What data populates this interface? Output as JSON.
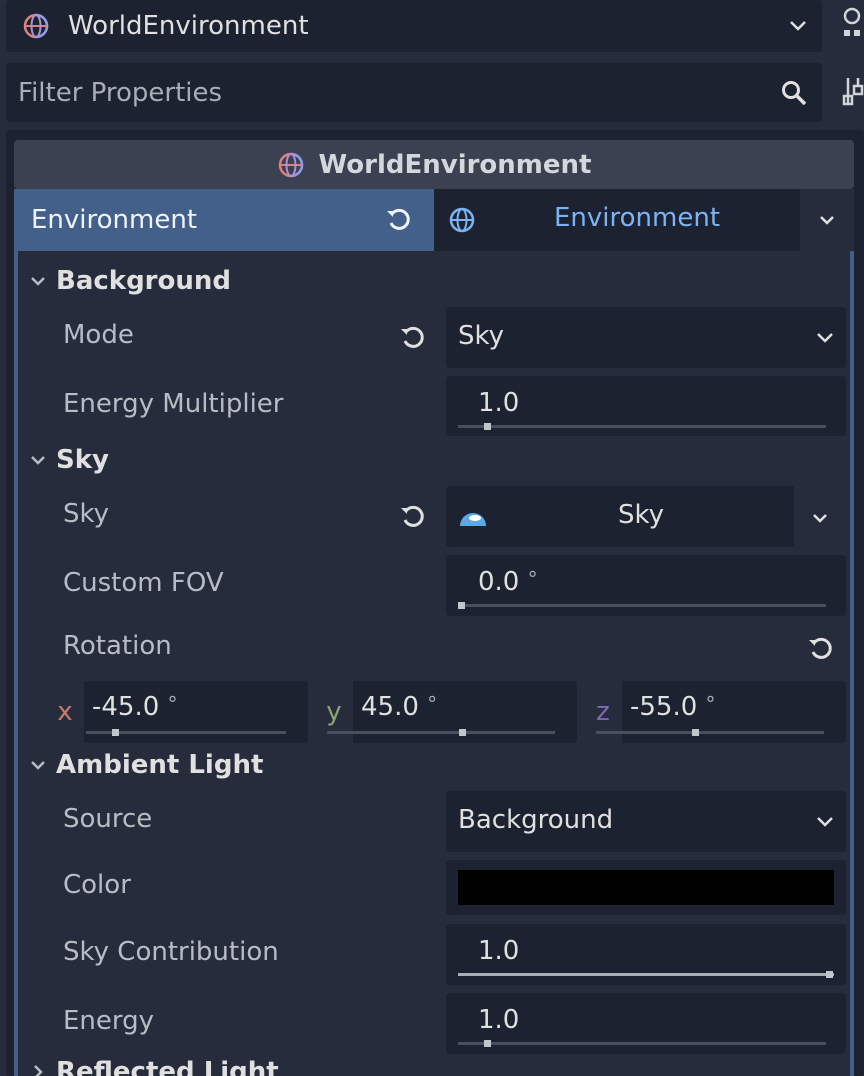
{
  "node_selector": {
    "name": "WorldEnvironment"
  },
  "filter": {
    "placeholder": "Filter Properties"
  },
  "object_header": {
    "title": "WorldEnvironment"
  },
  "environment_property": {
    "label": "Environment",
    "resource": "Environment"
  },
  "sections": {
    "background": {
      "title": "Background",
      "mode": {
        "label": "Mode",
        "value": "Sky"
      },
      "energy_multiplier": {
        "label": "Energy Multiplier",
        "value": "1.0",
        "slider_fraction": 0.07
      }
    },
    "sky": {
      "title": "Sky",
      "sky": {
        "label": "Sky",
        "resource": "Sky"
      },
      "custom_fov": {
        "label": "Custom FOV",
        "value": "0.0",
        "unit": "°",
        "slider_fraction": 0.0
      },
      "rotation": {
        "label": "Rotation",
        "x": {
          "axis": "x",
          "value": "-45.0",
          "unit": "°",
          "slider_fraction": 0.13
        },
        "y": {
          "axis": "y",
          "value": "45.0",
          "unit": "°",
          "slider_fraction": 0.58
        },
        "z": {
          "axis": "z",
          "value": "-55.0",
          "unit": "°",
          "slider_fraction": 0.42
        }
      }
    },
    "ambient_light": {
      "title": "Ambient Light",
      "source": {
        "label": "Source",
        "value": "Background"
      },
      "color": {
        "label": "Color",
        "value": "#000000"
      },
      "sky_contribution": {
        "label": "Sky Contribution",
        "value": "1.0",
        "slider_fraction": 1.0
      },
      "energy": {
        "label": "Energy",
        "value": "1.0",
        "slider_fraction": 0.07
      }
    },
    "reflected_light": {
      "title": "Reflected Light"
    }
  },
  "colors": {
    "accent": "#43608a",
    "resource_text": "#7ab4f5",
    "axis_x": "#c77a6a",
    "axis_y": "#8aa572",
    "axis_z": "#7a6ab0"
  },
  "icons": {
    "node": "world-environment-icon",
    "search": "search-icon",
    "revert": "revert-icon",
    "dropdown": "chevron-down-icon",
    "collapse": "chevron-down-icon",
    "sky": "sky-resource-icon",
    "globe": "globe-icon"
  }
}
